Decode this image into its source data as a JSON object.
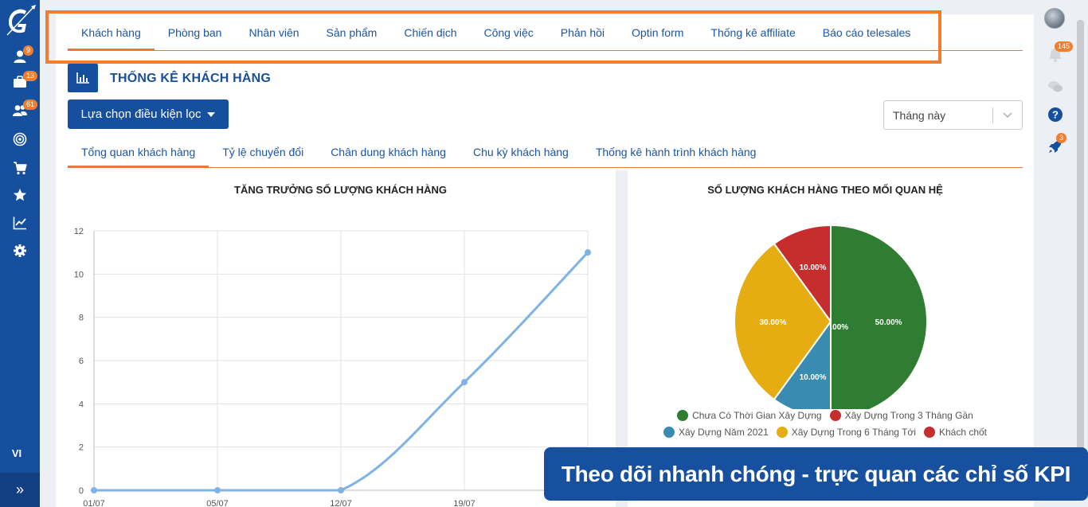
{
  "sidebar": {
    "items": [
      {
        "icon": "user-icon",
        "badge": "9"
      },
      {
        "icon": "briefcase-icon",
        "badge": "13"
      },
      {
        "icon": "users-icon",
        "badge": "61"
      },
      {
        "icon": "target-icon",
        "badge": ""
      },
      {
        "icon": "cart-icon",
        "badge": ""
      },
      {
        "icon": "star-icon",
        "badge": ""
      },
      {
        "icon": "chart-line-icon",
        "badge": ""
      },
      {
        "icon": "gear-icon",
        "badge": ""
      }
    ],
    "language": "VI",
    "expand_icon": "double-chevron-right-icon"
  },
  "rail": {
    "notifications_badge": "145",
    "rocket_badge": "3"
  },
  "top_tabs": [
    "Khách hàng",
    "Phòng ban",
    "Nhân viên",
    "Sản phẩm",
    "Chiến dịch",
    "Công việc",
    "Phản hồi",
    "Optin form",
    "Thống kê affiliate",
    "Báo cáo telesales"
  ],
  "page_title": "THỐNG KÊ KHÁCH HÀNG",
  "filter_button": "Lựa chọn điều kiện lọc",
  "period_select": "Tháng này",
  "sub_tabs": [
    "Tổng quan khách hàng",
    "Tỷ lệ chuyển đổi",
    "Chân dung khách hàng",
    "Chu kỳ khách hàng",
    "Thống kê hành trình khách hàng"
  ],
  "promo_text": "Theo dõi nhanh chóng  - trực quan các chỉ số KPI",
  "colors": {
    "primary": "#174f9f",
    "accent": "#e8783b"
  },
  "chart_data": [
    {
      "type": "line",
      "title": "TĂNG TRƯỞNG SỐ LƯỢNG KHÁCH HÀNG",
      "x": [
        "01/07",
        "05/07",
        "12/07",
        "19/07",
        ""
      ],
      "y": [
        0,
        0,
        0,
        5,
        11
      ],
      "ylim": [
        0,
        12
      ],
      "yticks": [
        0,
        2,
        4,
        6,
        8,
        10,
        12
      ],
      "grid": true,
      "color": "#7fb2e5"
    },
    {
      "type": "pie",
      "title": "SỐ LƯỢNG KHÁCH HÀNG THEO MỐI QUAN HỆ",
      "slices": [
        {
          "label": "Chưa Có Thời Gian Xây Dựng",
          "value": 50,
          "text": "50.00%",
          "color": "#2e7d32"
        },
        {
          "label": "Khách chốt",
          "value": 0,
          "text": "0.00%",
          "color": "#c62d2d"
        },
        {
          "label": "Xây Dựng Năm 2021",
          "value": 10,
          "text": "10.00%",
          "color": "#3a8bb0"
        },
        {
          "label": "Xây Dựng Trong 6 Tháng Tới",
          "value": 30,
          "text": "30.00%",
          "color": "#e5ad12"
        },
        {
          "label": "Xây Dựng Trong 3 Tháng Gần",
          "value": 10,
          "text": "10.00%",
          "color": "#c62d2d"
        }
      ],
      "legend": [
        [
          "Chưa Có Thời Gian Xây Dựng",
          "Xây Dựng Trong 3 Tháng Gần"
        ],
        [
          "Xây Dựng Năm 2021",
          "Xây Dựng Trong 6 Tháng Tới",
          "Khách chốt"
        ]
      ],
      "legend_colors": [
        [
          "#2e7d32",
          "#c62d2d"
        ],
        [
          "#3a8bb0",
          "#e5ad12",
          "#c62d2d"
        ]
      ],
      "legend_position": "bottom"
    }
  ]
}
